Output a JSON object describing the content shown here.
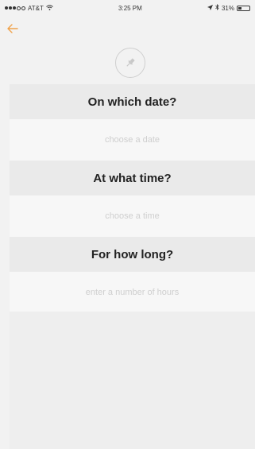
{
  "status_bar": {
    "carrier": "AT&T",
    "time": "3:25 PM",
    "battery": "31%",
    "battery_fraction": 0.31
  },
  "nav": {
    "back_icon": "arrow-left-icon"
  },
  "header_icon": "pin-icon",
  "sections": {
    "date": {
      "title": "On which date?",
      "placeholder": "choose a date"
    },
    "time": {
      "title": "At what time?",
      "placeholder": "choose a time"
    },
    "duration": {
      "title": "For how long?",
      "placeholder": "enter a number of hours"
    }
  },
  "colors": {
    "accent": "#f0a24a",
    "title_bg": "#eaeaea",
    "page_bg": "#f2f2f2"
  }
}
